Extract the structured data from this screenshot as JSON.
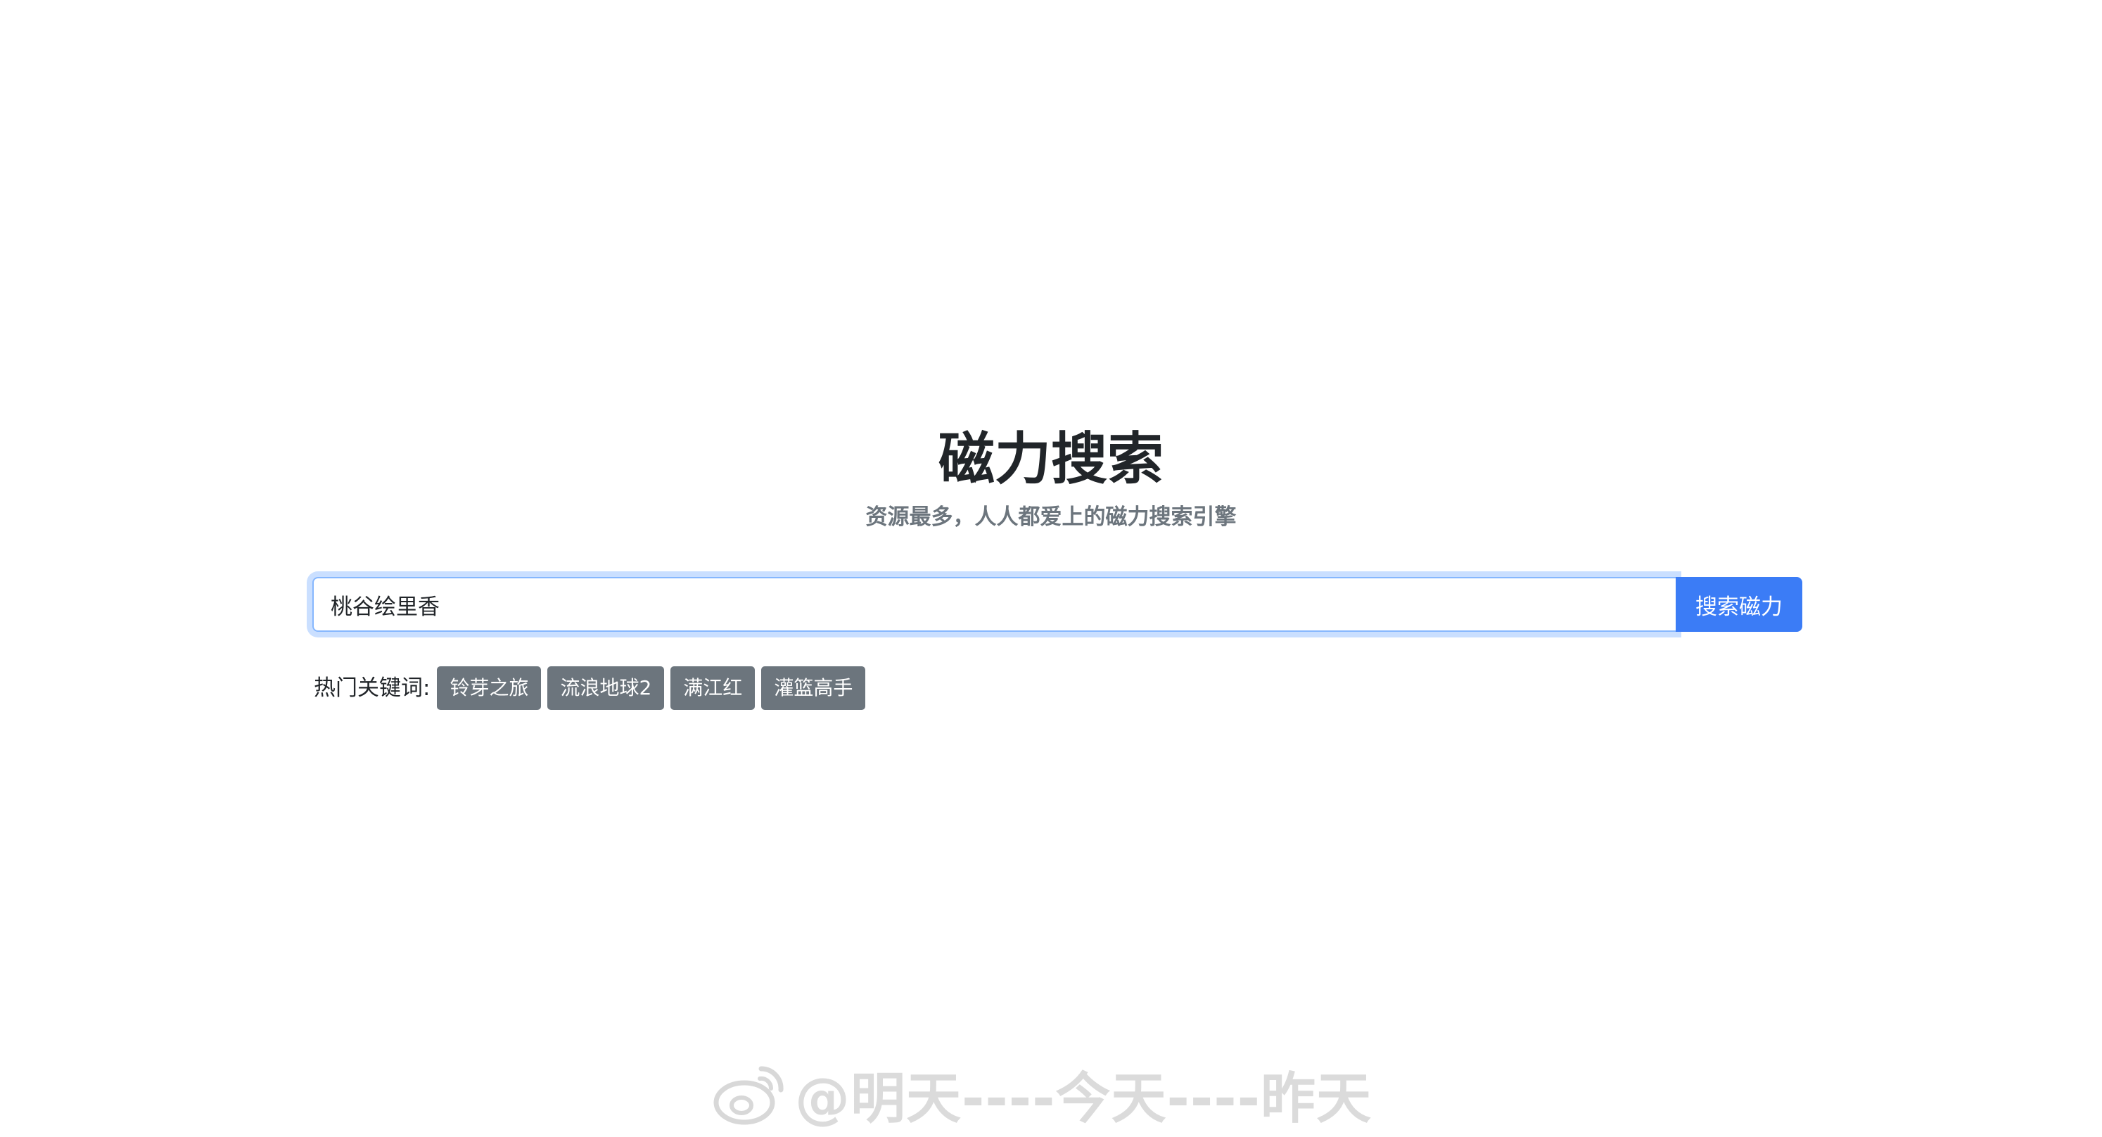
{
  "header": {
    "title": "磁力搜索",
    "subtitle": "资源最多，人人都爱上的磁力搜索引擎"
  },
  "search": {
    "value": "桃谷绘里香",
    "placeholder": "",
    "button_label": "搜索磁力"
  },
  "hot_keywords": {
    "label": "热门关键词:",
    "items": [
      "铃芽之旅",
      "流浪地球2",
      "满江红",
      "灌篮高手"
    ]
  },
  "watermark": {
    "text": "@明天----今天----昨天",
    "icon": "weibo-icon"
  },
  "colors": {
    "primary_button": "#3b7cf6",
    "tag_background": "#6c757d",
    "title_text": "#212529",
    "subtitle_text": "#6c757d"
  }
}
